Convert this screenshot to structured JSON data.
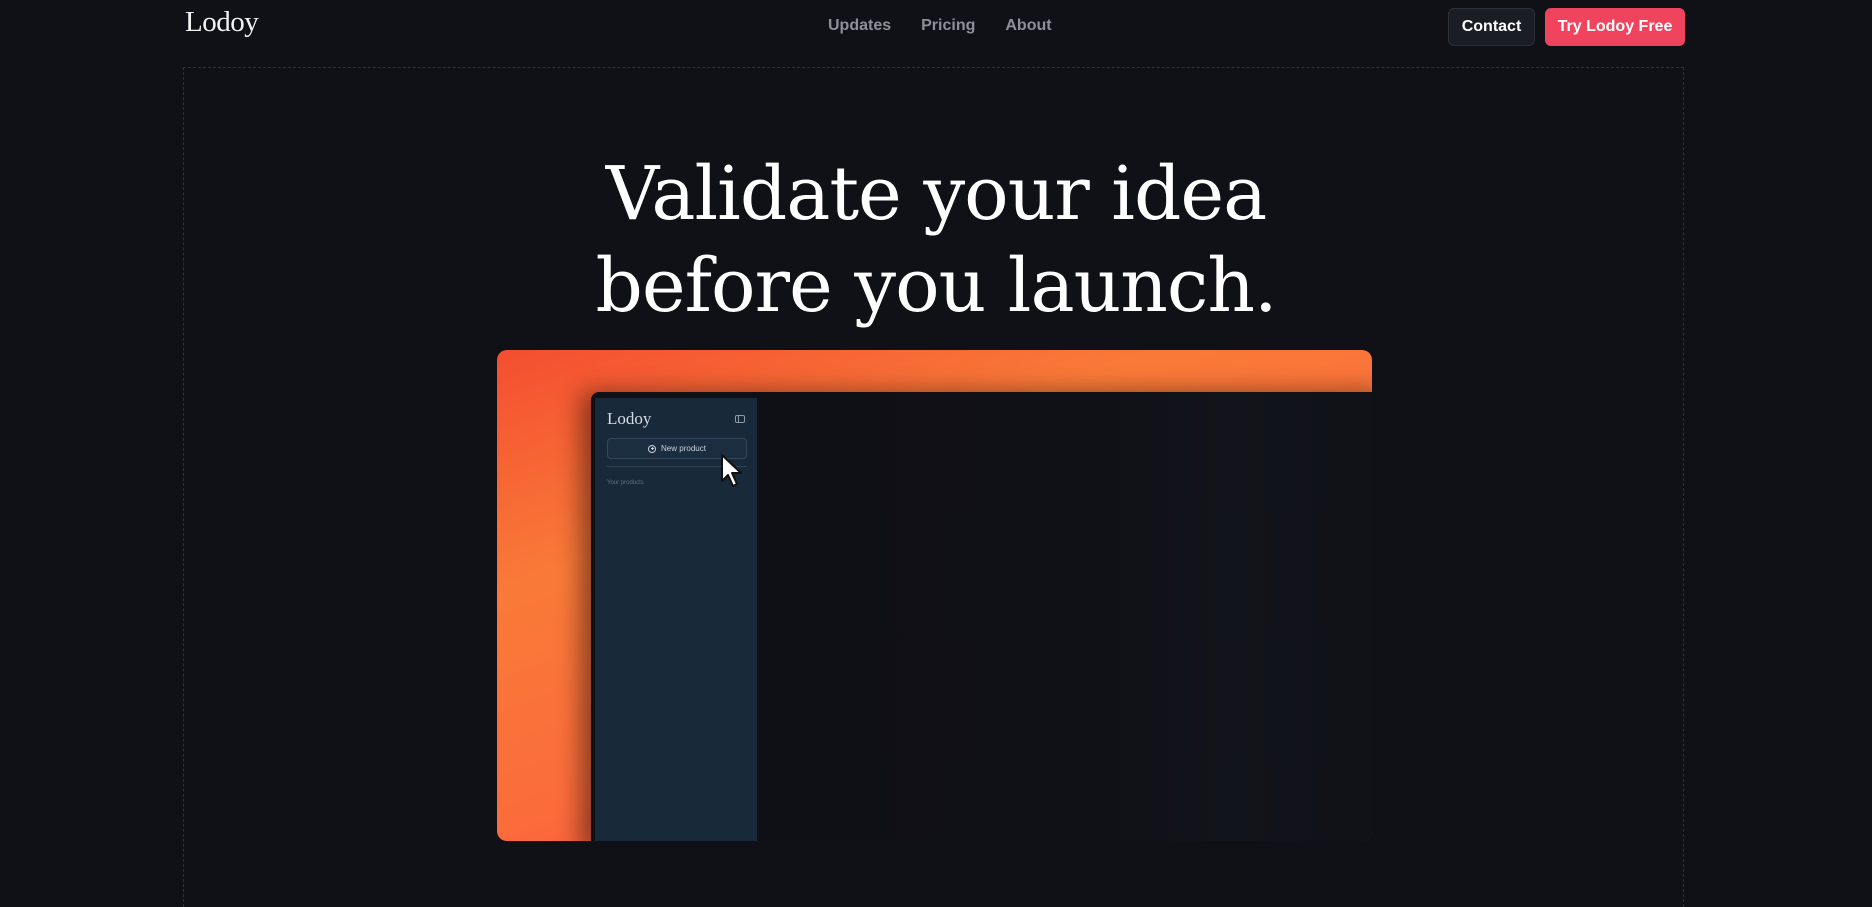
{
  "nav": {
    "logo": "Lodoy",
    "links": [
      "Updates",
      "Pricing",
      "About"
    ],
    "contact_label": "Contact",
    "cta_label": "Try Lodoy Free"
  },
  "hero": {
    "title_line1": "Validate your idea",
    "title_line2": "before you launch."
  },
  "app_preview": {
    "logo": "Lodoy",
    "new_product_label": "New product",
    "section_label": "Your products"
  },
  "colors": {
    "background": "#101116",
    "cta": "#f0445e",
    "showcase_gradient_start": "#f44e30",
    "showcase_gradient_end": "#f0303a",
    "sidebar": "#18293a"
  }
}
